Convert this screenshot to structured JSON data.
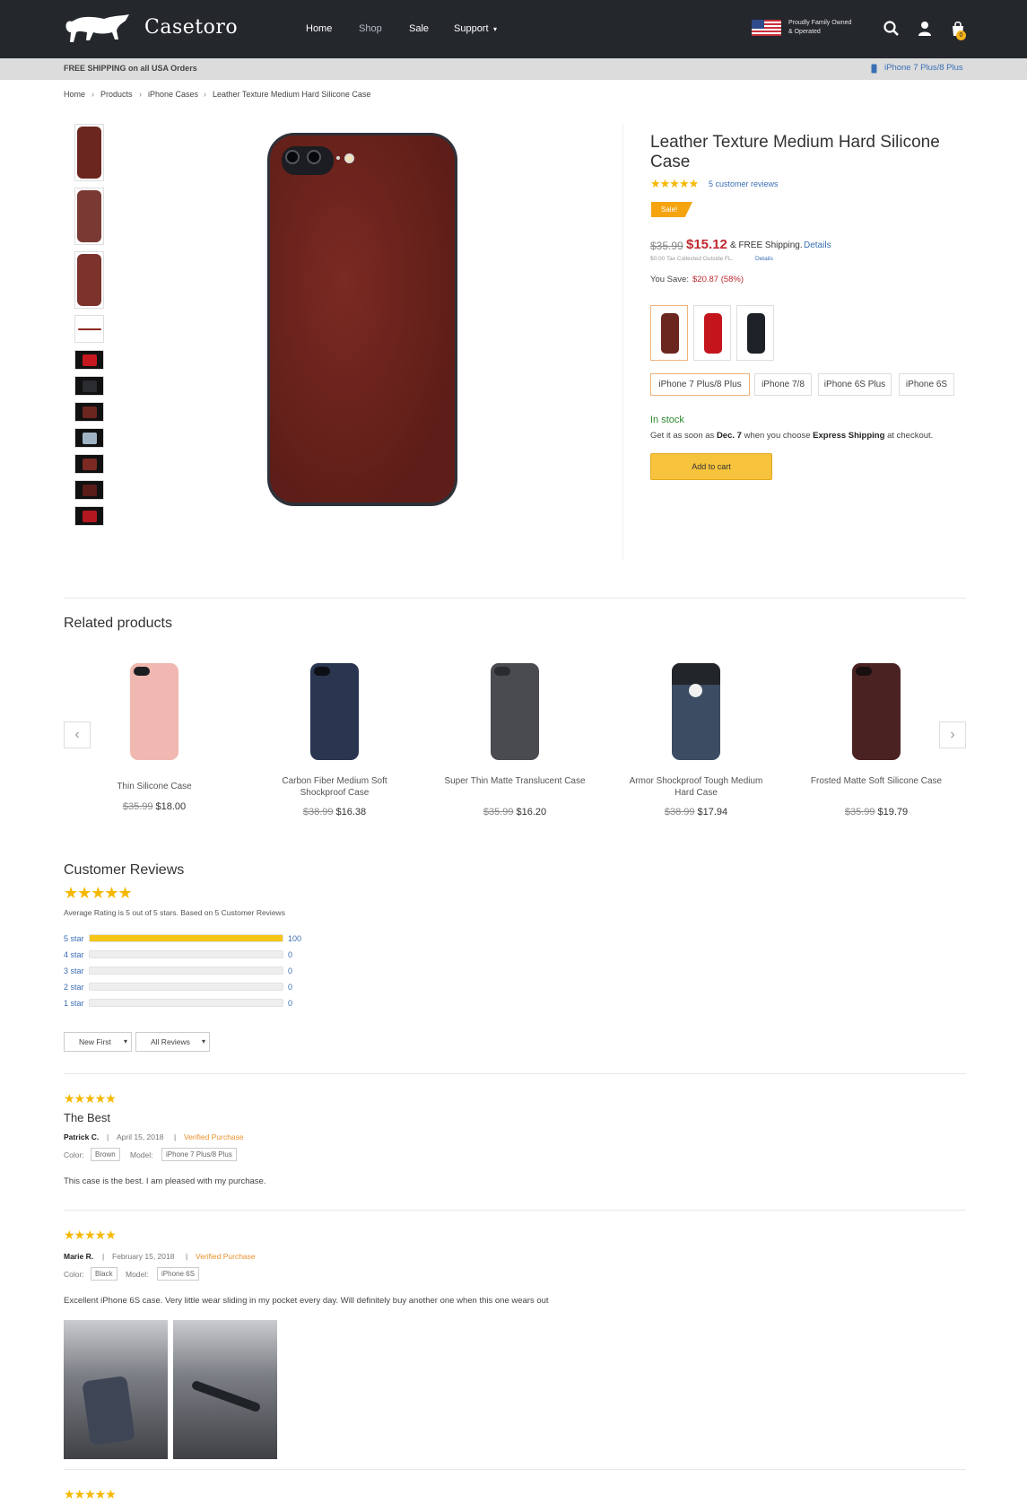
{
  "header": {
    "brand": "Casetoro",
    "nav": [
      "Home",
      "Shop",
      "Sale",
      "Support"
    ],
    "tagline": "Proudly Family Owned & Operated",
    "cart_count": "0"
  },
  "strip": {
    "shipping": "FREE SHIPPING on all USA Orders",
    "model": "iPhone 7 Plus/8 Plus"
  },
  "breadcrumb": [
    "Home",
    "Products",
    "iPhone Cases",
    "Leather Texture Medium Hard Silicone Case"
  ],
  "product": {
    "title": "Leather Texture Medium Hard Silicone Case",
    "stars": "★★★★★",
    "reviews_link": "5 customer reviews",
    "sale_badge": "Sale!",
    "old_price": "$35.99",
    "price": "$15.12",
    "shipping": "& FREE Shipping.",
    "details": "Details",
    "tax": "$0.00 Tax Collected Outside FL.",
    "tax_details": "Details",
    "you_save_label": "You Save:",
    "you_save": "$20.87 (58%)",
    "colors": [
      "#6b2620",
      "#c4151d",
      "#1e2128"
    ],
    "models": [
      "iPhone 7 Plus/8 Plus",
      "iPhone 7/8",
      "iPhone 6S Plus",
      "iPhone 6S"
    ],
    "stock": "In stock",
    "delivery": {
      "pre": "Get it as soon as",
      "date": "Dec. 7",
      "mid": "when you choose",
      "method": "Express Shipping",
      "post": "at checkout."
    },
    "add_to_cart": "Add to cart"
  },
  "related": {
    "heading": "Related products",
    "items": [
      {
        "name": "Thin Silicone Case",
        "old": "$35.99",
        "price": "$18.00",
        "color": "#f0b8b1"
      },
      {
        "name": "Carbon Fiber Medium Soft Shockproof Case",
        "old": "$38.99",
        "price": "$16.38",
        "color": "#2a3550"
      },
      {
        "name": "Super Thin Matte Translucent Case",
        "old": "$35.99",
        "price": "$16.20",
        "color": "#4a4b50"
      },
      {
        "name": "Armor Shockproof Tough Medium Hard Case",
        "old": "$38.99",
        "price": "$17.94",
        "color": "#3b4c63"
      },
      {
        "name": "Frosted Matte Soft Silicone Case",
        "old": "$35.99",
        "price": "$19.79",
        "color": "#4a2222"
      }
    ]
  },
  "reviews": {
    "heading": "Customer Reviews",
    "stars": "★★★★★",
    "average": "Average Rating is 5 out of 5 stars. Based on 5 Customer Reviews",
    "breakdown": [
      {
        "label": "5 star",
        "count": "100",
        "fill": 1
      },
      {
        "label": "4 star",
        "count": "0",
        "fill": 0
      },
      {
        "label": "3 star",
        "count": "0",
        "fill": 0
      },
      {
        "label": "2 star",
        "count": "0",
        "fill": 0
      },
      {
        "label": "1 star",
        "count": "0",
        "fill": 0
      }
    ],
    "sort": "New First",
    "filter": "All Reviews",
    "list": [
      {
        "title": "The Best",
        "author": "Patrick C.",
        "date": "April 15, 2018",
        "verified": "Verified Purchase",
        "color_label": "Color:",
        "color": "Brown",
        "model_label": "Model:",
        "model": "iPhone 7 Plus/8 Plus",
        "text": "This case is the best. I am pleased with my purchase."
      },
      {
        "author": "Marie R.",
        "date": "February 15, 2018",
        "verified": "Verified Purchase",
        "color_label": "Color:",
        "color": "Black",
        "model_label": "Model:",
        "model": "iPhone 6S",
        "text": "Excellent iPhone 6S case. Very little wear sliding in my pocket every day. Will definitely buy another one when this one wears out"
      }
    ]
  }
}
